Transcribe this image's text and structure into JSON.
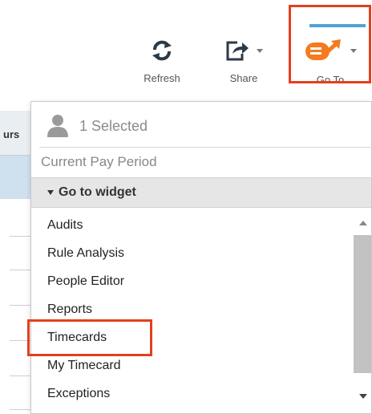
{
  "toolbar": {
    "refresh_label": "Refresh",
    "share_label": "Share",
    "goto_label": "Go To"
  },
  "background_table": {
    "header_text": "urs"
  },
  "dropdown": {
    "selected_text": "1 Selected",
    "pay_period": "Current Pay Period",
    "widget_header": "Go to widget",
    "items": [
      {
        "label": "Audits"
      },
      {
        "label": "Rule Analysis"
      },
      {
        "label": "People Editor"
      },
      {
        "label": "Reports"
      },
      {
        "label": "Timecards"
      },
      {
        "label": "My Timecard"
      },
      {
        "label": "Exceptions"
      }
    ]
  },
  "colors": {
    "accent_orange": "#f47b20",
    "highlight_red": "#e3401f",
    "goto_bar_blue": "#4ea3d8"
  },
  "icons": {
    "refresh": "refresh-icon",
    "share": "share-icon",
    "goto": "goto-icon",
    "person": "person-icon"
  }
}
